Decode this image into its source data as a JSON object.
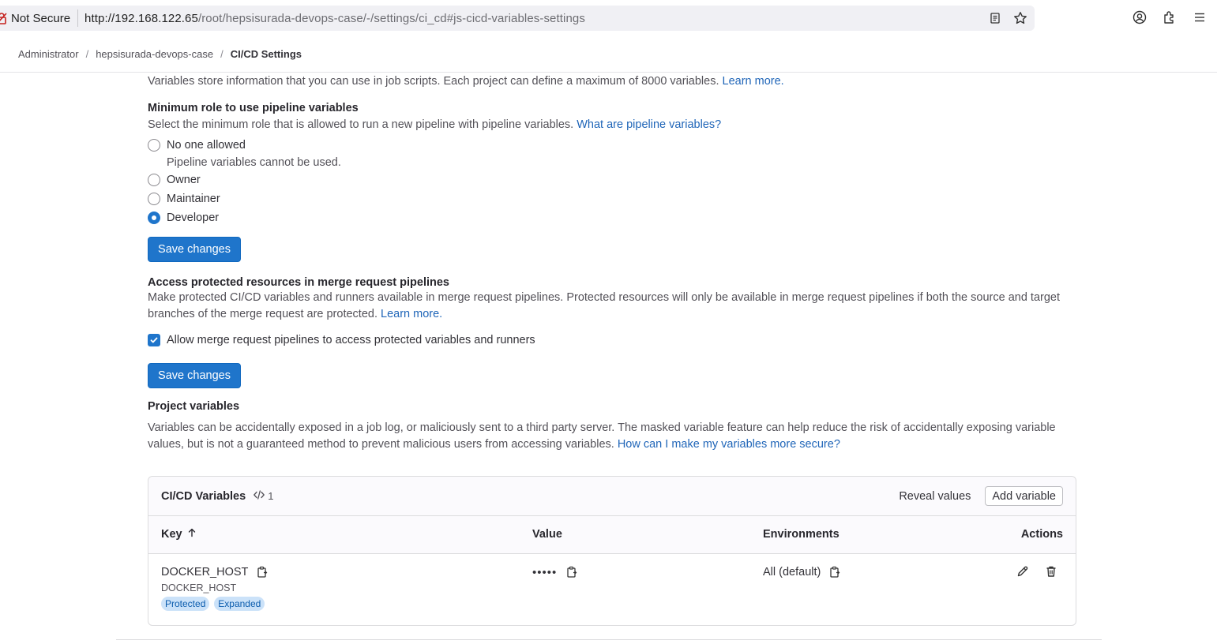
{
  "browser": {
    "not_secure": "Not Secure",
    "url_host": "http://192.168.122.65",
    "url_path": "/root/hepsisurada-devops-case/-/settings/ci_cd#js-cicd-variables-settings"
  },
  "breadcrumb": {
    "items": [
      "Administrator",
      "hepsisurada-devops-case"
    ],
    "current": "CI/CD Settings"
  },
  "intro": {
    "text": "Variables store information that you can use in job scripts. Each project can define a maximum of 8000 variables.",
    "link": "Learn more."
  },
  "min_role": {
    "title": "Minimum role to use pipeline variables",
    "description": "Select the minimum role that is allowed to run a new pipeline with pipeline variables.",
    "link": "What are pipeline variables?",
    "options": [
      {
        "label": "No one allowed",
        "help": "Pipeline variables cannot be used.",
        "checked": false
      },
      {
        "label": "Owner",
        "checked": false
      },
      {
        "label": "Maintainer",
        "checked": false
      },
      {
        "label": "Developer",
        "checked": true
      }
    ],
    "save_label": "Save changes"
  },
  "protected_resources": {
    "title": "Access protected resources in merge request pipelines",
    "description": "Make protected CI/CD variables and runners available in merge request pipelines. Protected resources will only be available in merge request pipelines if both the source and target branches of the merge request are protected.",
    "link": "Learn more.",
    "checkbox_label": "Allow merge request pipelines to access protected variables and runners",
    "checked": true,
    "save_label": "Save changes"
  },
  "project_variables": {
    "title": "Project variables",
    "description": "Variables can be accidentally exposed in a job log, or maliciously sent to a third party server. The masked variable feature can help reduce the risk of accidentally exposing variable values, but is not a guaranteed method to prevent malicious users from accessing variables.",
    "link": "How can I make my variables more secure?"
  },
  "variables_card": {
    "title": "CI/CD Variables",
    "count": "1",
    "reveal_label": "Reveal values",
    "add_label": "Add variable",
    "columns": {
      "key": "Key",
      "value": "Value",
      "environments": "Environments",
      "actions": "Actions"
    },
    "rows": [
      {
        "key": "DOCKER_HOST",
        "description": "DOCKER_HOST",
        "badges": [
          "Protected",
          "Expanded"
        ],
        "value": "•••••",
        "environment": "All (default)"
      }
    ]
  },
  "colors": {
    "primary": "#1f75cb",
    "link": "#1f65b8",
    "badge_bg": "#cbe2f9"
  }
}
